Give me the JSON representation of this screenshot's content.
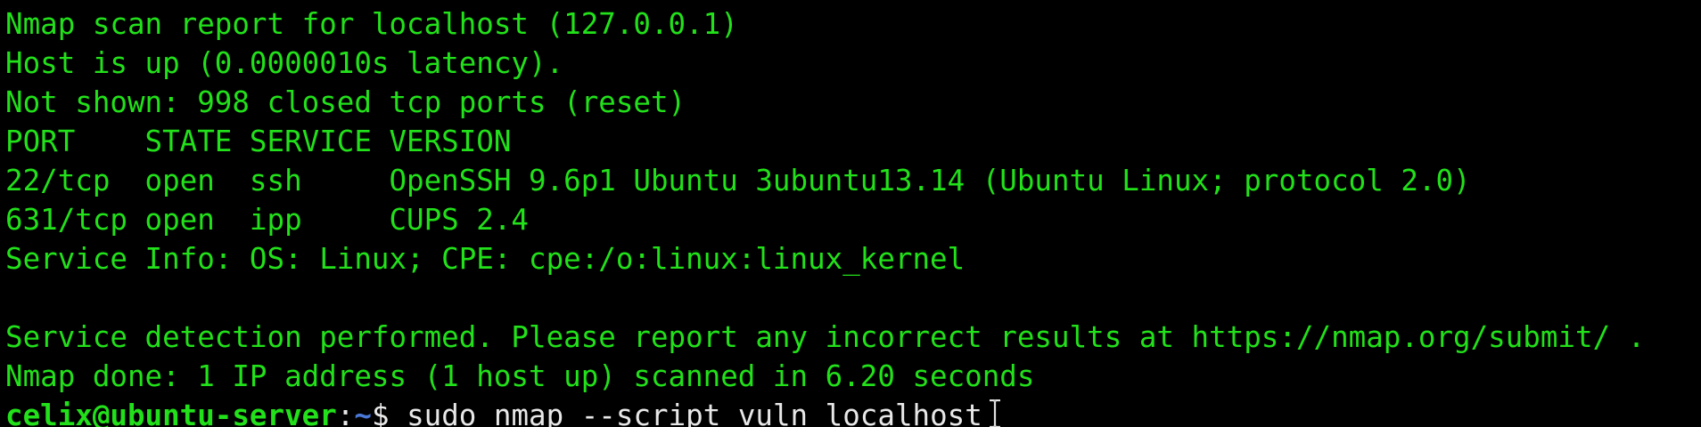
{
  "terminal": {
    "lines": [
      "Nmap scan report for localhost (127.0.0.1)",
      "Host is up (0.0000010s latency).",
      "Not shown: 998 closed tcp ports (reset)",
      "PORT    STATE SERVICE VERSION",
      "22/tcp  open  ssh     OpenSSH 9.6p1 Ubuntu 3ubuntu13.14 (Ubuntu Linux; protocol 2.0)",
      "631/tcp open  ipp     CUPS 2.4",
      "Service Info: OS: Linux; CPE: cpe:/o:linux:linux_kernel",
      "",
      "Service detection performed. Please report any incorrect results at https://nmap.org/submit/ .",
      "Nmap done: 1 IP address (1 host up) scanned in 6.20 seconds"
    ],
    "prompt": {
      "user_host": "celix@ubuntu-server",
      "separator": ":",
      "path": "~",
      "symbol": "$ ",
      "command": "sudo nmap --script vuln localhost"
    },
    "cursor_icon": "text-cursor-ibeam-icon",
    "colors": {
      "background": "#000000",
      "output_text": "#22e01a",
      "prompt_user": "#22e01a",
      "prompt_path": "#4a78d6",
      "command_text": "#e8e8e8"
    }
  }
}
